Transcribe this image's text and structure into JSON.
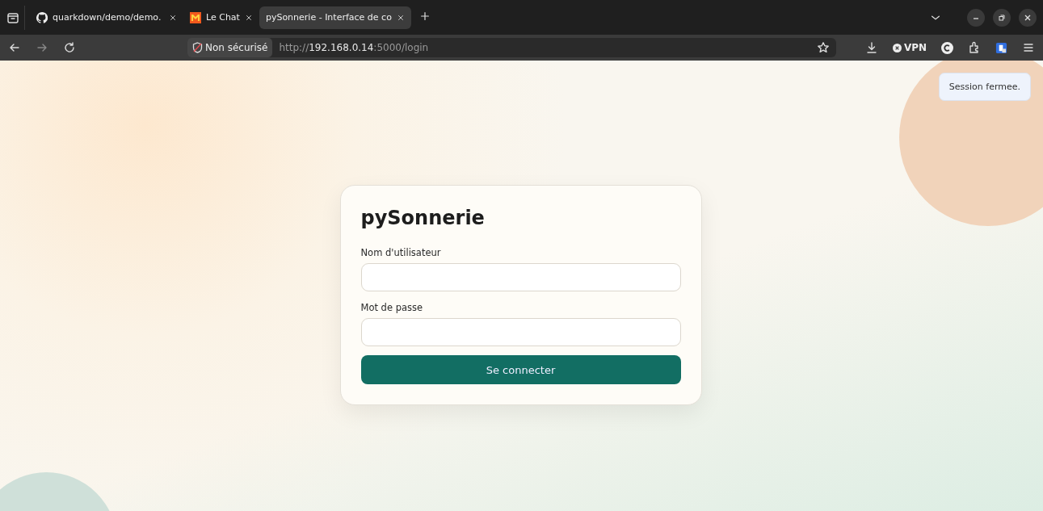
{
  "browser": {
    "tabs": [
      {
        "title": "quarkdown/demo/demo.",
        "selected": false
      },
      {
        "title": "Le Chat",
        "selected": false
      },
      {
        "title": "pySonnerie - Interface de co",
        "selected": true
      }
    ],
    "address": {
      "security": "Non sécurisé",
      "scheme": "http://",
      "host": "192.168.0.14",
      "rest": ":5000/login"
    },
    "vpn_label": "VPN"
  },
  "toast": {
    "message": "Session fermee."
  },
  "login": {
    "title": "pySonnerie",
    "fields": [
      {
        "label": "Nom d'utilisateur"
      },
      {
        "label": "Mot de passe"
      }
    ],
    "submit": "Se connecter"
  }
}
